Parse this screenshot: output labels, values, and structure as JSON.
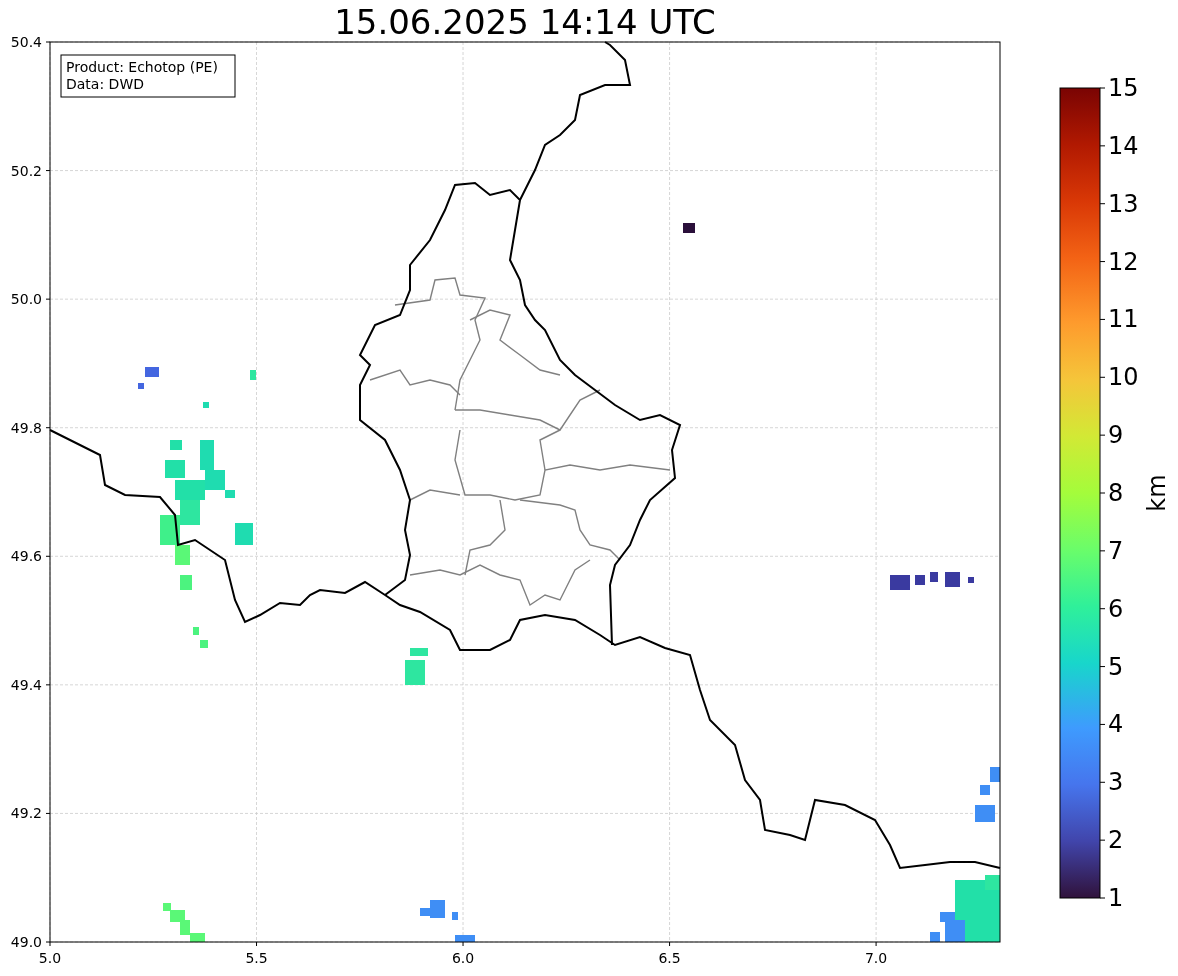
{
  "title": "15.06.2025 14:14 UTC",
  "legend": [
    "Product: Echotop (PE)",
    "Data: DWD"
  ],
  "x_ticks": [
    "5.0",
    "5.5",
    "6.0",
    "6.5",
    "7.0"
  ],
  "y_ticks": [
    "50.4",
    "50.2",
    "50.0",
    "49.8",
    "49.6",
    "49.4",
    "49.2",
    "49.0"
  ],
  "colorbar": {
    "label": "km",
    "ticks": [
      "15",
      "14",
      "13",
      "12",
      "11",
      "10",
      "9",
      "8",
      "7",
      "6",
      "5",
      "4",
      "3",
      "2",
      "1"
    ]
  }
}
